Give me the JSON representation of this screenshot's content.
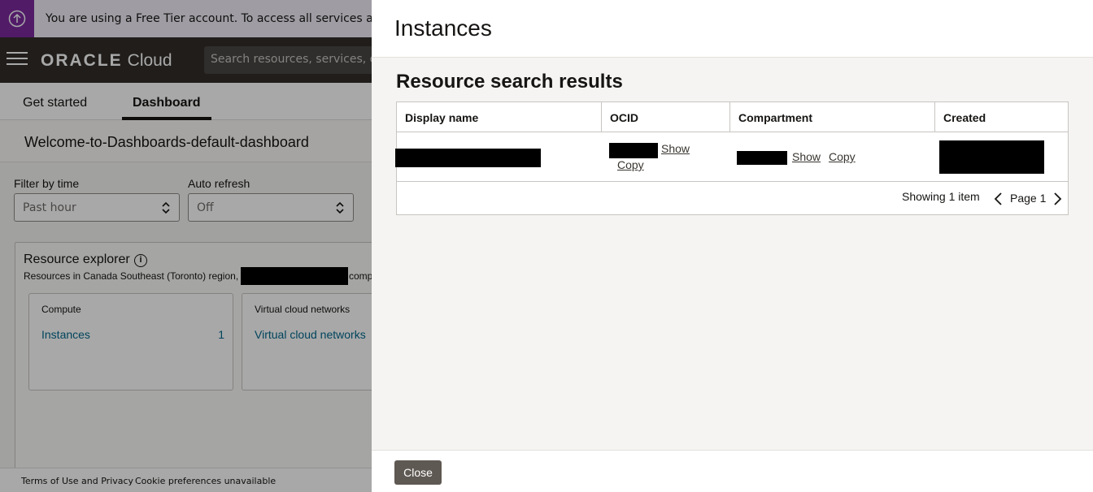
{
  "banner": {
    "text": "You are using a Free Tier account. To access all services and resources, upgrade to a paid account."
  },
  "header": {
    "logo_oracle": "ORACLE",
    "logo_cloud": "Cloud",
    "search_placeholder": "Search resources, services, documentation, and Marketplace"
  },
  "tabs": [
    {
      "label": "Get started",
      "active": false
    },
    {
      "label": "Dashboard",
      "active": true
    }
  ],
  "dashboard": {
    "title": "Welcome-to-Dashboards-default-dashboard",
    "filter_time_label": "Filter by time",
    "filter_time_value": "Past hour",
    "auto_refresh_label": "Auto refresh",
    "auto_refresh_value": "Off"
  },
  "explorer": {
    "title": "Resource explorer",
    "subtitle_prefix": "Resources in Canada Southeast (Toronto) region,",
    "subtitle_suffix": "comp",
    "cards": [
      {
        "title": "Compute",
        "link": "Instances",
        "count": "1"
      },
      {
        "title": "Virtual cloud networks",
        "link": "Virtual cloud networks",
        "count": ""
      }
    ]
  },
  "footer": {
    "terms": "Terms of Use and Privacy",
    "cookies": "Cookie preferences unavailable"
  },
  "drawer": {
    "title": "Instances",
    "results_title": "Resource search results",
    "columns": [
      "Display name",
      "OCID",
      "Compartment",
      "Created"
    ],
    "row": {
      "ocid_show": "Show",
      "ocid_copy": "Copy",
      "compartment_show": "Show",
      "compartment_copy": "Copy"
    },
    "pager": {
      "showing": "Showing 1 item",
      "page": "Page 1"
    },
    "close_label": "Close"
  },
  "colors": {
    "accent_purple": "#7b2a9e",
    "topbar": "#312d2a",
    "link": "#00688c",
    "close_button": "#5f5953"
  }
}
